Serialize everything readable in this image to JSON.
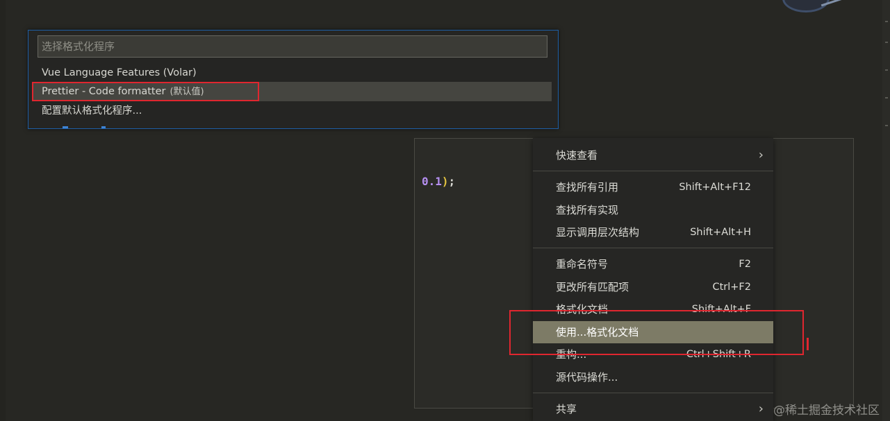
{
  "quick_pick": {
    "placeholder": "选择格式化程序",
    "items": [
      {
        "label": "Vue Language Features (Volar)",
        "description": ""
      },
      {
        "label": "Prettier - Code formatter",
        "description": "(默认值)"
      },
      {
        "label": "配置默认格式化程序...",
        "description": ""
      }
    ],
    "selected_index": 1
  },
  "editor": {
    "code_number": "0.1",
    "code_paren": ")",
    "code_semicolon": ";"
  },
  "context_menu": {
    "items": [
      {
        "label": "快速查看",
        "shortcut": "",
        "submenu": true
      },
      {
        "label": "查找所有引用",
        "shortcut": "Shift+Alt+F12"
      },
      {
        "label": "查找所有实现",
        "shortcut": ""
      },
      {
        "label": "显示调用层次结构",
        "shortcut": "Shift+Alt+H"
      },
      {
        "label": "重命名符号",
        "shortcut": "F2"
      },
      {
        "label": "更改所有匹配项",
        "shortcut": "Ctrl+F2"
      },
      {
        "label": "格式化文档",
        "shortcut": "Shift+Alt+F"
      },
      {
        "label": "使用...格式化文档",
        "shortcut": ""
      },
      {
        "label": "重构...",
        "shortcut": "Ctrl+Shift+R"
      },
      {
        "label": "源代码操作...",
        "shortcut": ""
      },
      {
        "label": "共享",
        "shortcut": "",
        "submenu": true
      }
    ],
    "highlighted_index": 7,
    "submenu_arrow": "›"
  },
  "watermark": "@稀土掘金技术社区",
  "colors": {
    "highlight_bg": "#7d7b66",
    "annotation_red": "#e0262f",
    "focus_border": "#1e5fa6",
    "number_purple": "#b58ff0",
    "paren_yellow": "#e3c340"
  }
}
